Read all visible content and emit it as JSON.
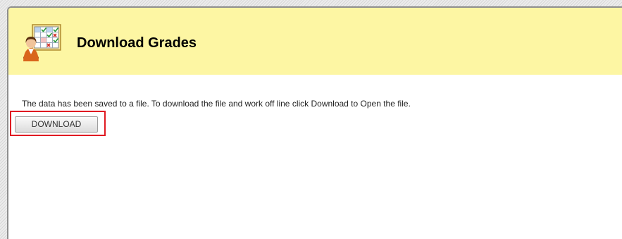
{
  "header": {
    "icon": "gradebook-user-icon",
    "title": "Download Grades"
  },
  "main": {
    "message": "The data has been saved to a file. To download the file and work off line click Download to Open the file.",
    "download_button": "DOWNLOAD"
  },
  "colors": {
    "header_background": "#fdf6a3",
    "highlight_border": "#e01a22"
  }
}
